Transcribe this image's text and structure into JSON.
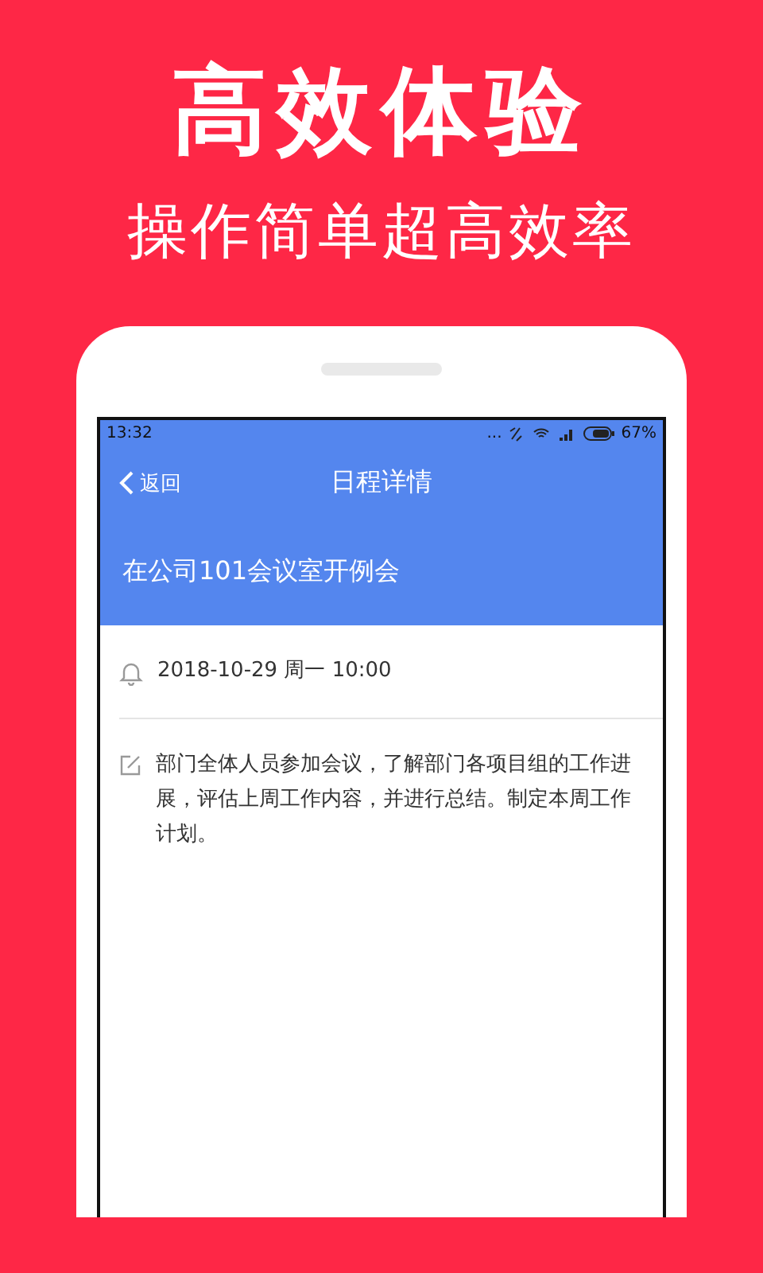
{
  "headline": "高效体验",
  "subheadline": "操作简单超高效率",
  "status_bar": {
    "time": "13:32",
    "dots": "...",
    "battery": "67%"
  },
  "nav": {
    "back": "返回",
    "title": "日程详情"
  },
  "event_title": "在公司101会议室开例会",
  "details": [
    {
      "kind": "reminder",
      "text": "2018-10-29 周一 10:00"
    },
    {
      "kind": "note",
      "text": "部门全体人员参加会议，了解部门各项目组的工作进展，评估上周工作内容，并进行总结。制定本周工作计划。"
    }
  ]
}
